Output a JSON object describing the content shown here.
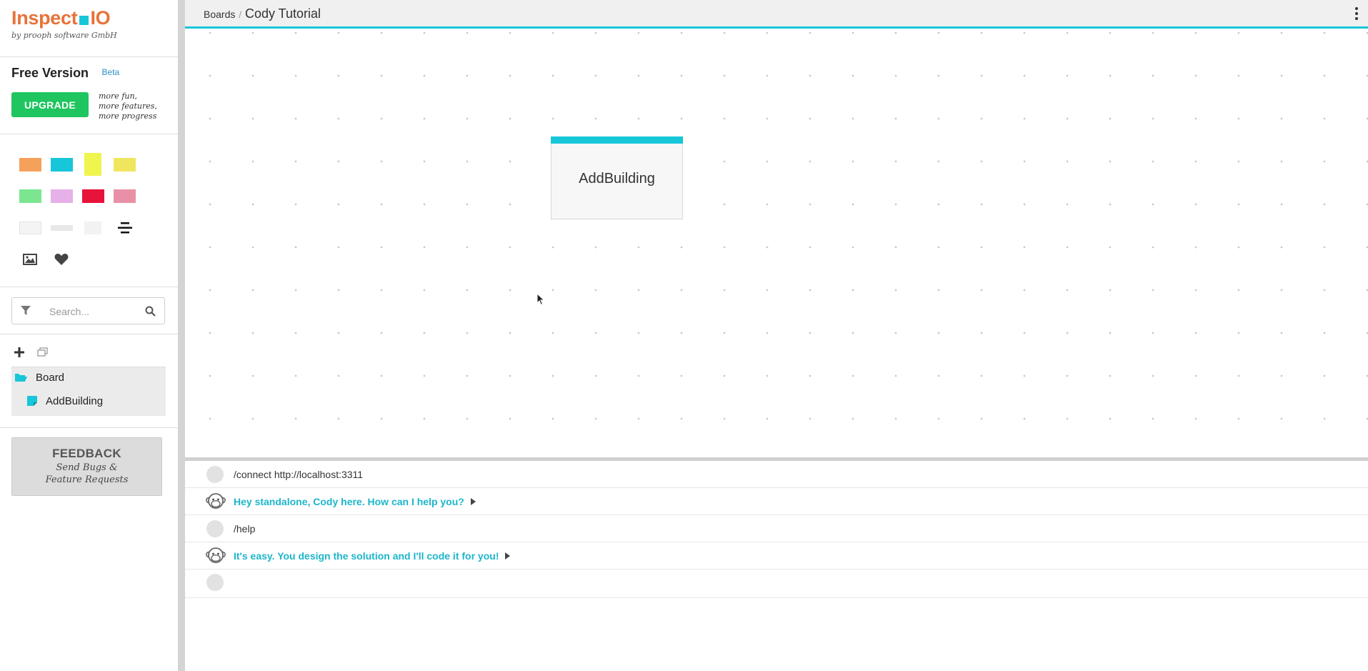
{
  "logo": {
    "name_part1": "Inspect",
    "name_part2": "IO",
    "tagline": "by prooph software GmbH"
  },
  "plan": {
    "title": "Free Version",
    "badge": "Beta",
    "upgrade_label": "UPGRADE",
    "upgrade_note": "more fun, more features, more progress"
  },
  "palette": {
    "colors": [
      "#f6a15b",
      "#17c6d9",
      "#eff54e",
      "#f0e65e",
      "#7be68f",
      "#e6b0e8",
      "#e8133a",
      "#e891a6",
      "#f4f4f4",
      "#e8e8e8",
      "#f2f2f2"
    ],
    "icons": [
      "align-center-icon",
      "image-icon",
      "heart-icon"
    ]
  },
  "search": {
    "placeholder": "Search..."
  },
  "tree": {
    "root": "Board",
    "children": [
      "AddBuilding"
    ]
  },
  "feedback": {
    "title": "FEEDBACK",
    "subtitle": "Send Bugs & Feature Requests"
  },
  "header": {
    "breadcrumb_root": "Boards",
    "separator": "/",
    "board_title": "Cody Tutorial"
  },
  "canvas": {
    "sticky_label": "AddBuilding",
    "sticky_color": "#17c6d9"
  },
  "console": {
    "rows": [
      {
        "type": "user",
        "text": "/connect http://localhost:3311"
      },
      {
        "type": "bot",
        "text": "Hey standalone, Cody here. How can I help you?"
      },
      {
        "type": "user",
        "text": "/help"
      },
      {
        "type": "bot",
        "text": "It's easy. You design the solution and I'll code it for you!"
      },
      {
        "type": "input",
        "text": ""
      }
    ]
  },
  "colors": {
    "accent": "#17c6d9",
    "brand": "#e8733a",
    "upgrade": "#1fc55f",
    "bot_text": "#1cb6cb"
  }
}
